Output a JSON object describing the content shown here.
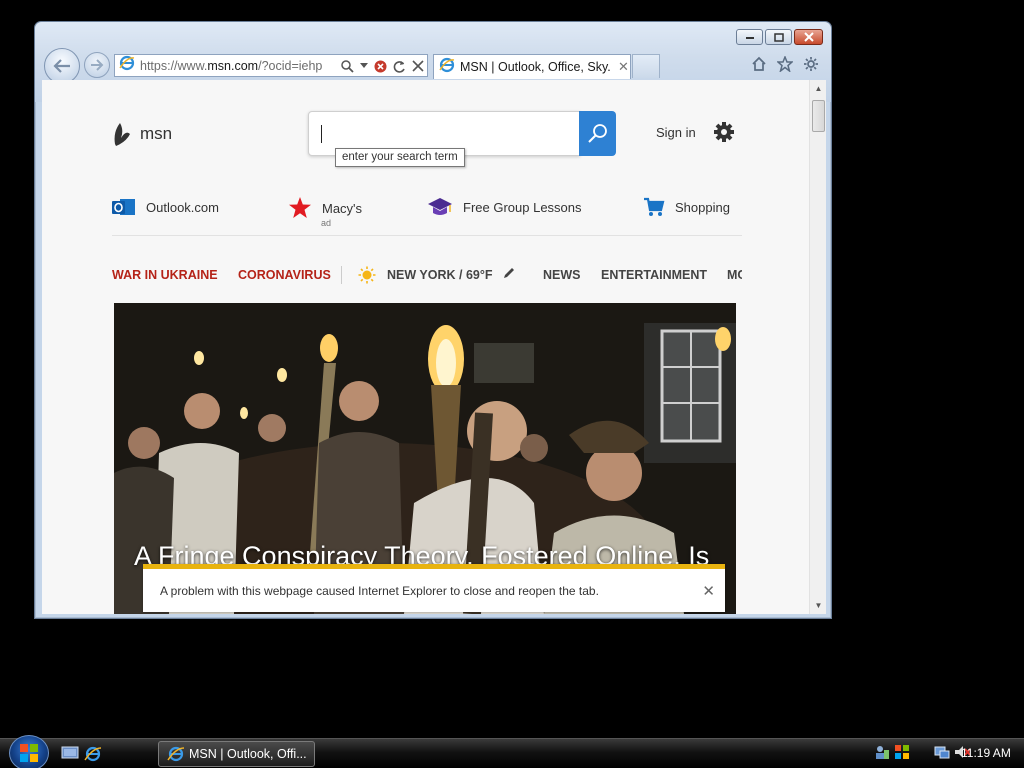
{
  "browser": {
    "address_url_prefix": "https://www.",
    "address_url_domain": "msn.com",
    "address_url_suffix": "/?ocid=iehp",
    "tab_title": "MSN | Outlook, Office, Sky..."
  },
  "msn": {
    "logo_text": "msn",
    "search_tooltip": "enter your search term",
    "signin_label": "Sign in",
    "quick_links": [
      {
        "label": "Outlook.com",
        "sub": ""
      },
      {
        "label": "Macy's",
        "sub": "ad"
      },
      {
        "label": "Free Group Lessons",
        "sub": ""
      },
      {
        "label": "Shopping",
        "sub": ""
      }
    ],
    "nav": [
      {
        "label": "WAR IN UKRAINE"
      },
      {
        "label": "CORONAVIRUS"
      },
      {
        "label": "NEW YORK / 69°F"
      },
      {
        "label": "NEWS"
      },
      {
        "label": "ENTERTAINMENT"
      },
      {
        "label": "MO"
      }
    ],
    "hero_title": "A Fringe Conspiracy Theory, Fostered Online, Is",
    "notification_text": "A problem with this webpage caused Internet Explorer to close and reopen the tab."
  },
  "taskbar": {
    "task_label": "MSN | Outlook, Offi...",
    "clock": "11:19 AM"
  },
  "colors": {
    "accent_blue": "#2e81d3",
    "nav_red": "#b52318",
    "notif_yellow": "#e8b30f"
  }
}
